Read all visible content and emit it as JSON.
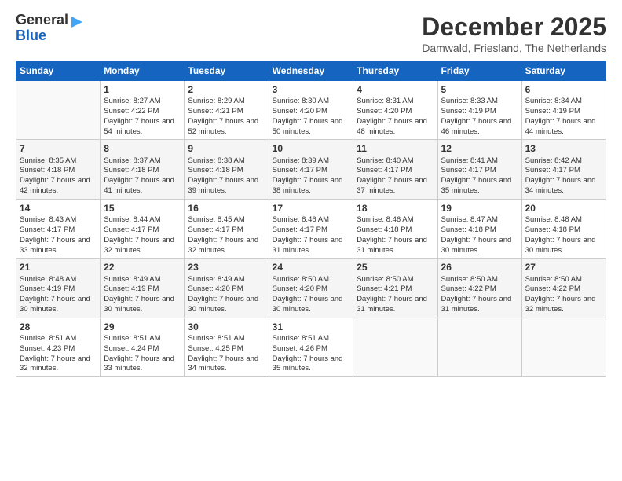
{
  "header": {
    "logo_line1": "General",
    "logo_line2": "Blue",
    "month_title": "December 2025",
    "location": "Damwald, Friesland, The Netherlands"
  },
  "days_of_week": [
    "Sunday",
    "Monday",
    "Tuesday",
    "Wednesday",
    "Thursday",
    "Friday",
    "Saturday"
  ],
  "weeks": [
    [
      {
        "day": "",
        "info": ""
      },
      {
        "day": "1",
        "info": "Sunrise: 8:27 AM\nSunset: 4:22 PM\nDaylight: 7 hours\nand 54 minutes."
      },
      {
        "day": "2",
        "info": "Sunrise: 8:29 AM\nSunset: 4:21 PM\nDaylight: 7 hours\nand 52 minutes."
      },
      {
        "day": "3",
        "info": "Sunrise: 8:30 AM\nSunset: 4:20 PM\nDaylight: 7 hours\nand 50 minutes."
      },
      {
        "day": "4",
        "info": "Sunrise: 8:31 AM\nSunset: 4:20 PM\nDaylight: 7 hours\nand 48 minutes."
      },
      {
        "day": "5",
        "info": "Sunrise: 8:33 AM\nSunset: 4:19 PM\nDaylight: 7 hours\nand 46 minutes."
      },
      {
        "day": "6",
        "info": "Sunrise: 8:34 AM\nSunset: 4:19 PM\nDaylight: 7 hours\nand 44 minutes."
      }
    ],
    [
      {
        "day": "7",
        "info": "Sunrise: 8:35 AM\nSunset: 4:18 PM\nDaylight: 7 hours\nand 42 minutes."
      },
      {
        "day": "8",
        "info": "Sunrise: 8:37 AM\nSunset: 4:18 PM\nDaylight: 7 hours\nand 41 minutes."
      },
      {
        "day": "9",
        "info": "Sunrise: 8:38 AM\nSunset: 4:18 PM\nDaylight: 7 hours\nand 39 minutes."
      },
      {
        "day": "10",
        "info": "Sunrise: 8:39 AM\nSunset: 4:17 PM\nDaylight: 7 hours\nand 38 minutes."
      },
      {
        "day": "11",
        "info": "Sunrise: 8:40 AM\nSunset: 4:17 PM\nDaylight: 7 hours\nand 37 minutes."
      },
      {
        "day": "12",
        "info": "Sunrise: 8:41 AM\nSunset: 4:17 PM\nDaylight: 7 hours\nand 35 minutes."
      },
      {
        "day": "13",
        "info": "Sunrise: 8:42 AM\nSunset: 4:17 PM\nDaylight: 7 hours\nand 34 minutes."
      }
    ],
    [
      {
        "day": "14",
        "info": "Sunrise: 8:43 AM\nSunset: 4:17 PM\nDaylight: 7 hours\nand 33 minutes."
      },
      {
        "day": "15",
        "info": "Sunrise: 8:44 AM\nSunset: 4:17 PM\nDaylight: 7 hours\nand 32 minutes."
      },
      {
        "day": "16",
        "info": "Sunrise: 8:45 AM\nSunset: 4:17 PM\nDaylight: 7 hours\nand 32 minutes."
      },
      {
        "day": "17",
        "info": "Sunrise: 8:46 AM\nSunset: 4:17 PM\nDaylight: 7 hours\nand 31 minutes."
      },
      {
        "day": "18",
        "info": "Sunrise: 8:46 AM\nSunset: 4:18 PM\nDaylight: 7 hours\nand 31 minutes."
      },
      {
        "day": "19",
        "info": "Sunrise: 8:47 AM\nSunset: 4:18 PM\nDaylight: 7 hours\nand 30 minutes."
      },
      {
        "day": "20",
        "info": "Sunrise: 8:48 AM\nSunset: 4:18 PM\nDaylight: 7 hours\nand 30 minutes."
      }
    ],
    [
      {
        "day": "21",
        "info": "Sunrise: 8:48 AM\nSunset: 4:19 PM\nDaylight: 7 hours\nand 30 minutes."
      },
      {
        "day": "22",
        "info": "Sunrise: 8:49 AM\nSunset: 4:19 PM\nDaylight: 7 hours\nand 30 minutes."
      },
      {
        "day": "23",
        "info": "Sunrise: 8:49 AM\nSunset: 4:20 PM\nDaylight: 7 hours\nand 30 minutes."
      },
      {
        "day": "24",
        "info": "Sunrise: 8:50 AM\nSunset: 4:20 PM\nDaylight: 7 hours\nand 30 minutes."
      },
      {
        "day": "25",
        "info": "Sunrise: 8:50 AM\nSunset: 4:21 PM\nDaylight: 7 hours\nand 31 minutes."
      },
      {
        "day": "26",
        "info": "Sunrise: 8:50 AM\nSunset: 4:22 PM\nDaylight: 7 hours\nand 31 minutes."
      },
      {
        "day": "27",
        "info": "Sunrise: 8:50 AM\nSunset: 4:22 PM\nDaylight: 7 hours\nand 32 minutes."
      }
    ],
    [
      {
        "day": "28",
        "info": "Sunrise: 8:51 AM\nSunset: 4:23 PM\nDaylight: 7 hours\nand 32 minutes."
      },
      {
        "day": "29",
        "info": "Sunrise: 8:51 AM\nSunset: 4:24 PM\nDaylight: 7 hours\nand 33 minutes."
      },
      {
        "day": "30",
        "info": "Sunrise: 8:51 AM\nSunset: 4:25 PM\nDaylight: 7 hours\nand 34 minutes."
      },
      {
        "day": "31",
        "info": "Sunrise: 8:51 AM\nSunset: 4:26 PM\nDaylight: 7 hours\nand 35 minutes."
      },
      {
        "day": "",
        "info": ""
      },
      {
        "day": "",
        "info": ""
      },
      {
        "day": "",
        "info": ""
      }
    ]
  ]
}
